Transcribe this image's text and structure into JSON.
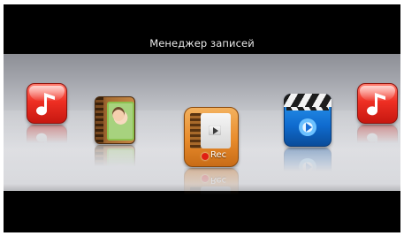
{
  "header": {
    "title": "Менеджер записей"
  },
  "carousel": {
    "items": [
      {
        "name": "music",
        "icon": "music-note-icon",
        "accent": "#e5271d"
      },
      {
        "name": "photos",
        "icon": "photo-album-icon",
        "accent": "#c58744"
      },
      {
        "name": "recorder",
        "icon": "recorder-icon",
        "label": "Rec",
        "accent": "#e88b2b",
        "selected": true
      },
      {
        "name": "video",
        "icon": "clapperboard-icon",
        "accent": "#0f6bcf"
      },
      {
        "name": "music",
        "icon": "music-note-icon",
        "accent": "#e5271d"
      }
    ]
  }
}
